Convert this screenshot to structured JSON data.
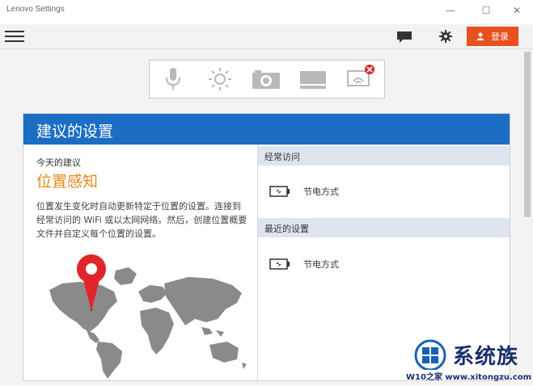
{
  "window": {
    "title": "Lenovo Settings",
    "minimize": "—",
    "maximize": "☐",
    "close": "✕"
  },
  "toolbar": {
    "login_label": "登录"
  },
  "quick_icons": [
    "microphone-icon",
    "brightness-icon",
    "camera-icon",
    "display-icon",
    "wifi-display-icon"
  ],
  "panel": {
    "title": "建议的设置",
    "today_label": "今天的建议",
    "feature_title": "位置感知",
    "feature_desc": "位置发生变化时自动更新特定于位置的设置。连接到经常访问的 WiFi 或以太网网络。然后，创建位置概要文件并自定义每个位置的设置。",
    "frequent_label": "经常访问",
    "frequent_item": "节电方式",
    "recent_label": "最近的设置",
    "recent_item": "节电方式"
  },
  "watermark": {
    "text": "系统族",
    "url": "W10之家 www.xitongzu.com"
  },
  "colors": {
    "accent": "#1c6ec4",
    "login": "#e8501d",
    "feature": "#e38b1f"
  }
}
